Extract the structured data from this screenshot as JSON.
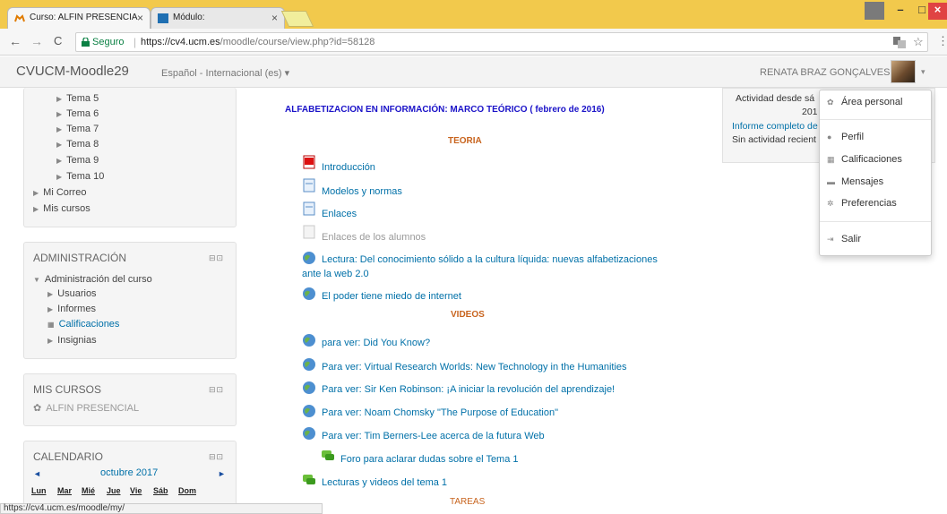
{
  "browser": {
    "tabs": [
      {
        "label": "Curso: ALFIN PRESENCIA",
        "close": "×"
      },
      {
        "label": "Módulo:",
        "close": "×"
      }
    ],
    "window_controls": [
      "–",
      "□",
      "×"
    ],
    "nav": {
      "back": "←",
      "forward": "→",
      "reload": "C"
    },
    "security": "Seguro",
    "url_scheme_host": "https://cv4.ucm.es",
    "url_path": "/moodle/course/view.php?id=58128",
    "status_url": "https://cv4.ucm.es/moodle/my/"
  },
  "header": {
    "brand": "CVUCM-Moodle29",
    "language": "Español - Internacional (es) ▾",
    "username": "RENATA BRAZ GONÇALVES",
    "caret": "▾"
  },
  "nav_block": {
    "items": [
      "Tema 5",
      "Tema 6",
      "Tema 7",
      "Tema 8",
      "Tema 9",
      "Tema 10"
    ],
    "extras": [
      "Mi Correo",
      "Mis cursos"
    ]
  },
  "admin_block": {
    "title": "ADMINISTRACIÓN",
    "root": "Administración del curso",
    "items": [
      "Usuarios",
      "Informes",
      "Calificaciones",
      "Insignias"
    ]
  },
  "courses_block": {
    "title": "MIS CURSOS",
    "item": "ALFIN PRESENCIAL"
  },
  "calendar_block": {
    "title": "CALENDARIO",
    "prev": "◄",
    "next": "►",
    "month": "octubre 2017",
    "days": [
      "Lun",
      "Mar",
      "Mié",
      "Jue",
      "Vie",
      "Sáb",
      "Dom"
    ]
  },
  "block_controls": "⊟⊡",
  "main": {
    "title": "ALFABETIZACION EN INFORMACIÓN: MARCO TEÓRICO ( febrero de 2016)",
    "teoria": "TEORIA",
    "videos": "VIDEOS",
    "tareas": "TAREAS",
    "teoria_items": [
      "Introducción",
      "Modelos y normas",
      "Enlaces",
      "Enlaces de los alumnos",
      "Lectura: Del conocimiento sólido a la cultura líquida: nuevas alfabetizaciones",
      "El poder tiene miedo de internet"
    ],
    "lectura_line2": "ante la web 2.0",
    "video_items": [
      "para ver: Did You Know?",
      "Para ver: Virtual Research Worlds: New Technology in the Humanities",
      "Para ver: Sir Ken Robinson: ¡A iniciar la revolución del aprendizaje!",
      "Para ver: Noam Chomsky \"The Purpose of Education\"",
      "Para ver: Tim Berners-Lee acerca de la futura Web"
    ],
    "forum": "Foro para aclarar dudas sobre el Tema 1",
    "lecturas": "Lecturas y videos del tema 1"
  },
  "right_block": {
    "line1": "Actividad desde sá",
    "line2": "201",
    "line3": "Informe completo de",
    "line4": "Sin actividad recient"
  },
  "user_menu": {
    "items": [
      "Área personal",
      "Perfil",
      "Calificaciones",
      "Mensajes",
      "Preferencias",
      "Salir"
    ]
  }
}
